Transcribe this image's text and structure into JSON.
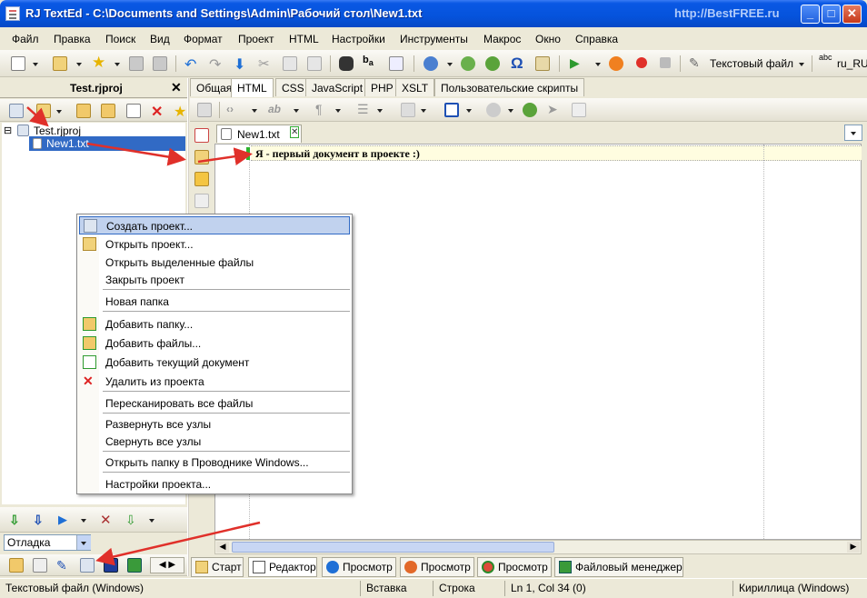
{
  "window": {
    "title": "RJ TextEd - C:\\Documents and Settings\\Admin\\Рабочий стол\\New1.txt",
    "watermark": "http://BestFREE.ru",
    "controls": {
      "minimize": "_",
      "maximize": "□",
      "close": "✕"
    }
  },
  "menubar": [
    "Файл",
    "Правка",
    "Поиск",
    "Вид",
    "Формат",
    "Проект",
    "HTML",
    "Настройки",
    "Инструменты",
    "Макрос",
    "Окно",
    "Справка"
  ],
  "toolbar": {
    "file_type": "Текстовый файл",
    "spell_lang": "ru_RU",
    "abc_label": "abc"
  },
  "project_panel": {
    "title": "Test.rjproj",
    "close": "✕",
    "tree": [
      {
        "label": "Test.rjproj",
        "toggle": "⊟"
      },
      {
        "label": "New1.txt",
        "selected": true
      }
    ],
    "debug_select": "Отладка"
  },
  "editor": {
    "tabs": [
      "Общая",
      "HTML",
      "CSS",
      "JavaScript",
      "PHP",
      "XSLT",
      "Пользовательские скрипты"
    ],
    "active_tab": "HTML",
    "doc_tab": "New1.txt",
    "doc_tab_close": "✕",
    "line_text": "Я - первый документ в проекте :)"
  },
  "context_menu": [
    {
      "label": "Создать проект...",
      "icon": "new-project-icon",
      "highlighted": true
    },
    {
      "label": "Открыть проект...",
      "icon": "open-project-icon"
    },
    {
      "label": "Открыть выделенные файлы"
    },
    {
      "label": "Закрыть проект"
    },
    {
      "label": "Новая папка"
    },
    {
      "label": "Добавить папку...",
      "icon": "add-folder-icon"
    },
    {
      "label": "Добавить файлы...",
      "icon": "add-files-icon"
    },
    {
      "label": "Добавить текущий документ",
      "icon": "add-document-icon"
    },
    {
      "label": "Удалить из проекта",
      "icon": "delete-icon"
    },
    {
      "label": "Пересканировать все файлы"
    },
    {
      "label": "Развернуть все узлы"
    },
    {
      "label": "Свернуть все узлы"
    },
    {
      "label": "Открыть папку в Проводнике Windows..."
    },
    {
      "label": "Настройки проекта..."
    }
  ],
  "bottom_tabs": [
    {
      "label": "Старт",
      "icon": "home-icon"
    },
    {
      "label": "Редактор",
      "icon": "editor-icon",
      "active": true
    },
    {
      "label": "Просмотр",
      "icon": "ie-icon"
    },
    {
      "label": "Просмотр",
      "icon": "firefox-icon"
    },
    {
      "label": "Просмотр",
      "icon": "chrome-icon"
    },
    {
      "label": "Файловый менеджер",
      "icon": "file-manager-icon"
    }
  ],
  "statusbar": {
    "file_type": "Текстовый файл (Windows)",
    "mode": "Вставка",
    "selection": "Строка",
    "position": "Ln 1, Col 34 (0)",
    "encoding": "Кириллица (Windows)"
  },
  "colors": {
    "titlebar": "#0553dc",
    "selection": "#316ac5",
    "menu_highlight": "#c1d2ee",
    "arrow": "#e0302a"
  }
}
